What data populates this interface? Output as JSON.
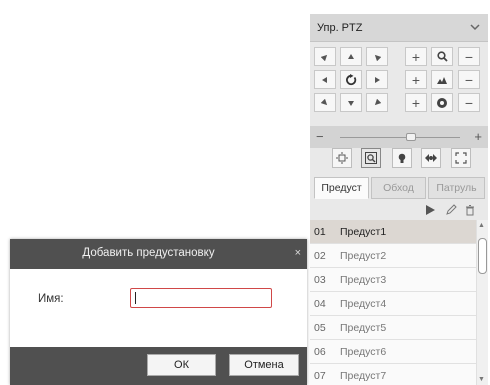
{
  "ptz_panel": {
    "title": "Упр. PTZ",
    "tabs": [
      {
        "label": "Предуст",
        "active": true
      },
      {
        "label": "Обход",
        "active": false
      },
      {
        "label": "Патруль",
        "active": false
      }
    ],
    "slider": {
      "minus": "−",
      "plus": "+",
      "level": 0.58
    },
    "presets": [
      {
        "num": "01",
        "name": "Предуст1",
        "selected": true
      },
      {
        "num": "02",
        "name": "Предуст2",
        "selected": false
      },
      {
        "num": "03",
        "name": "Предуст3",
        "selected": false
      },
      {
        "num": "04",
        "name": "Предуст4",
        "selected": false
      },
      {
        "num": "05",
        "name": "Предуст5",
        "selected": false
      },
      {
        "num": "06",
        "name": "Предуст6",
        "selected": false
      },
      {
        "num": "07",
        "name": "Предуст7",
        "selected": false
      }
    ],
    "pad_labels": {
      "plus": "+",
      "minus": "−"
    }
  },
  "dialog": {
    "title": "Добавить предустановку",
    "close": "×",
    "name_label": "Имя:",
    "name_value": "",
    "ok": "ОК",
    "cancel": "Отмена"
  },
  "colors": {
    "dialog_header": "#505050",
    "input_border": "#d04848",
    "selected_row": "#dcd7d2"
  }
}
